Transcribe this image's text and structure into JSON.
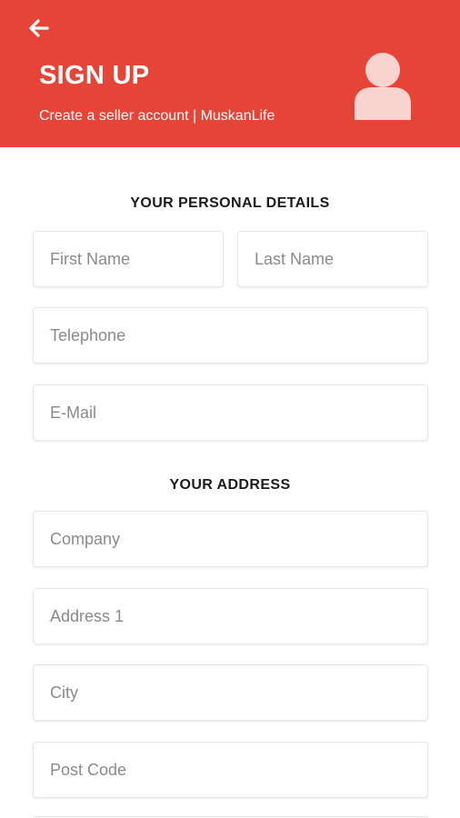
{
  "header": {
    "back_icon": "arrow-left-icon",
    "title": "SIGN UP",
    "subtitle": "Create a seller account | MuskanLife",
    "avatar_icon": "user-icon",
    "background_color": "#e54437"
  },
  "personal_details": {
    "heading": "YOUR PERSONAL DETAILS",
    "first_name": {
      "placeholder": "First Name",
      "value": ""
    },
    "last_name": {
      "placeholder": "Last Name",
      "value": ""
    },
    "telephone": {
      "placeholder": "Telephone",
      "value": ""
    },
    "email": {
      "placeholder": "E-Mail",
      "value": ""
    }
  },
  "address": {
    "heading": "YOUR ADDRESS",
    "company": {
      "placeholder": "Company",
      "value": ""
    },
    "address1": {
      "placeholder": "Address 1",
      "value": ""
    },
    "city": {
      "placeholder": "City",
      "value": ""
    },
    "post_code": {
      "placeholder": "Post Code",
      "value": ""
    }
  }
}
